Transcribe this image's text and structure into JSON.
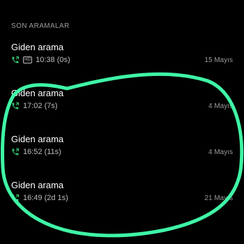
{
  "section": {
    "title": "SON ARAMALAR"
  },
  "calls": [
    {
      "title": "Giden arama",
      "hd": "HD",
      "time": "10:38 (0s)",
      "date": "15 Mayıs"
    },
    {
      "title": "Giden arama",
      "time": "17:02 (7s)",
      "date": "4 Mayıs"
    },
    {
      "title": "Giden arama",
      "time": "16:52 (11s)",
      "date": "4 Mayıs"
    },
    {
      "title": "Giden arama",
      "time": "16:49 (2d 1s)",
      "date": "21 Mayıs"
    }
  ],
  "colors": {
    "background": "#000000",
    "primary_text": "#ffffff",
    "secondary_text": "#9a9a9a",
    "call_icon": "#2ecc71",
    "annotation_stroke": "#3ff5a6"
  },
  "icons": {
    "call": "outgoing-call-icon",
    "hd": "hd-badge",
    "annotation": "hand-drawn-circle"
  }
}
